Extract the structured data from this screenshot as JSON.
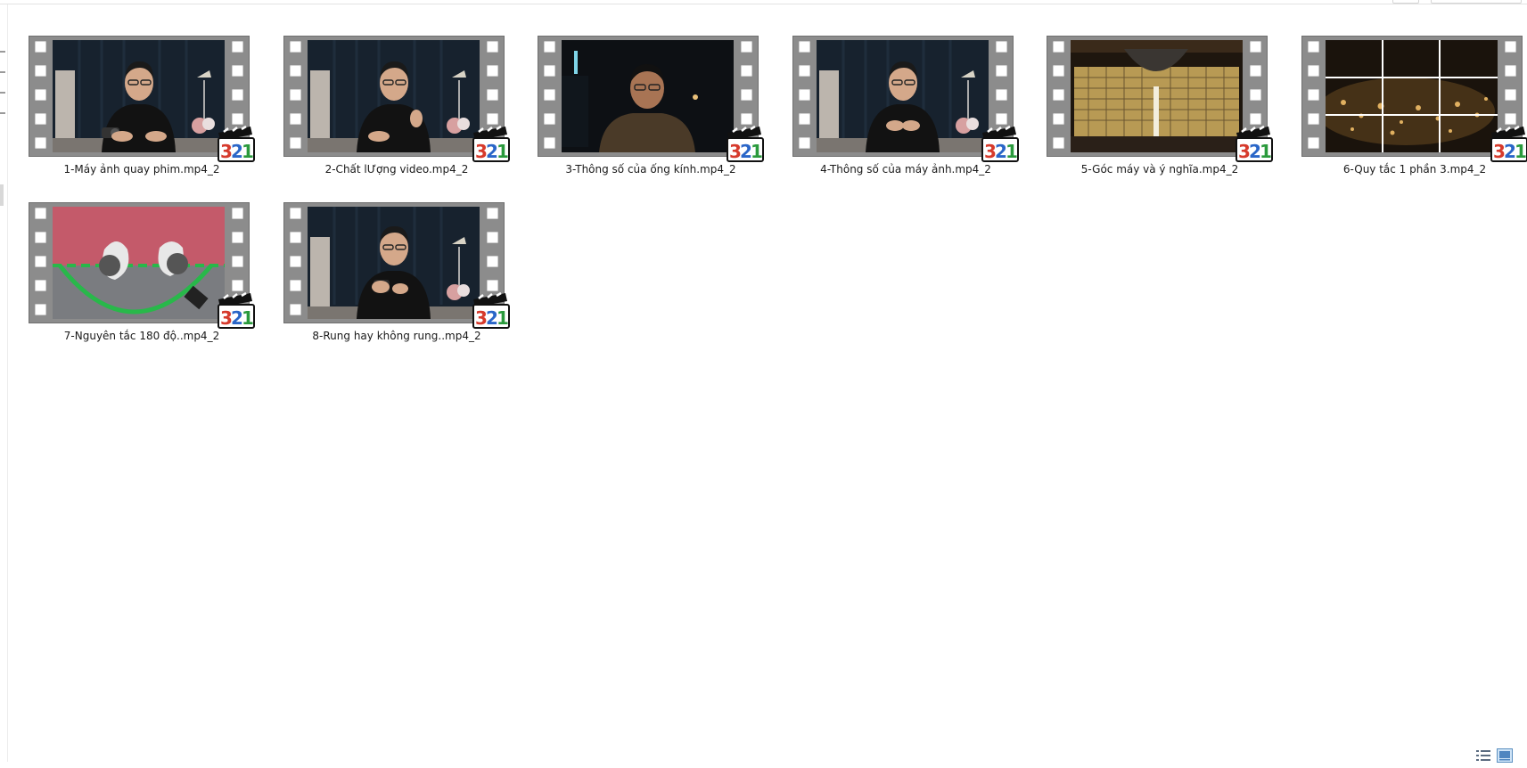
{
  "files": [
    {
      "name": "1-Máy ảnh quay phim.mp4_2",
      "thumb": "studio-host",
      "icon": "mpc-hc-321-icon"
    },
    {
      "name": "2-Chất lƯợng video.mp4_2",
      "thumb": "studio-host-gesture",
      "icon": "mpc-hc-321-icon"
    },
    {
      "name": "3-Thông số của ống kính.mp4_2",
      "thumb": "dark-portrait",
      "icon": "mpc-hc-321-icon"
    },
    {
      "name": "4-Thông số của máy ảnh.mp4_2",
      "thumb": "studio-host",
      "icon": "mpc-hc-321-icon"
    },
    {
      "name": "5-Góc máy và ý nghĩa.mp4_2",
      "thumb": "warehouse-door",
      "icon": "mpc-hc-321-icon"
    },
    {
      "name": "6-Quy tắc 1 phần 3.mp4_2",
      "thumb": "bokeh-grid",
      "icon": "mpc-hc-321-icon"
    },
    {
      "name": "7-Nguyên tắc 180 độ..mp4_2",
      "thumb": "180-rule-diagram",
      "icon": "mpc-hc-321-icon"
    },
    {
      "name": "8-Rung hay không rung..mp4_2",
      "thumb": "studio-host-camera",
      "icon": "mpc-hc-321-icon"
    }
  ],
  "colors": {
    "filmstrip": "#8c8c8c",
    "caption": "#1a1a1a",
    "background": "#ffffff"
  }
}
